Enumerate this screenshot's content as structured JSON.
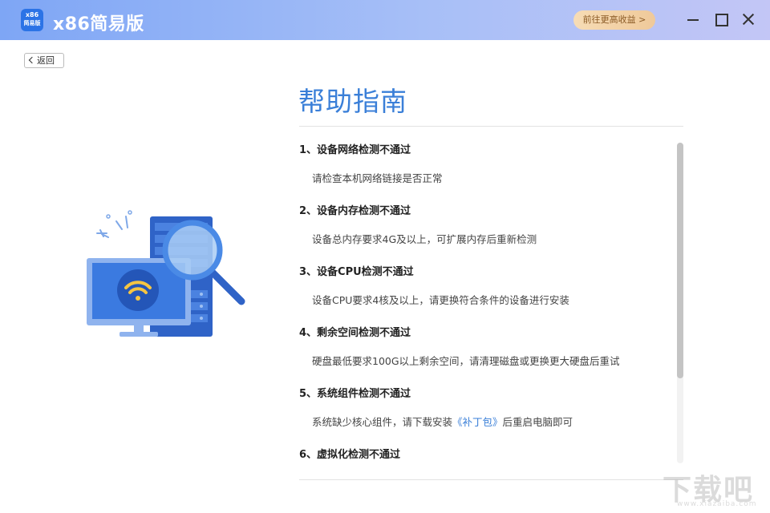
{
  "app": {
    "logo_line1": "x86",
    "logo_line2": "简易版",
    "title": "x86简易版",
    "promo_label": "前往更高收益 >",
    "icons": [
      "minimize-icon",
      "maximize-icon",
      "close-icon"
    ]
  },
  "nav": {
    "back_label": "返回"
  },
  "help": {
    "title": "帮助指南",
    "items": [
      {
        "q": "1、设备网络检测不通过",
        "a": "请检查本机网络链接是否正常"
      },
      {
        "q": "2、设备内存检测不通过",
        "a": "设备总内存要求4G及以上，可扩展内存后重新检测"
      },
      {
        "q": "3、设备CPU检测不通过",
        "a": "设备CPU要求4核及以上，请更换符合条件的设备进行安装"
      },
      {
        "q": "4、剩余空间检测不通过",
        "a": "硬盘最低要求100G以上剩余空间，请清理磁盘或更换更大硬盘后重试"
      },
      {
        "q": "5、系统组件检测不通过",
        "a_before": "系统缺少核心组件，请下载安装",
        "a_link": "《补丁包》",
        "a_after": "后重启电脑即可"
      },
      {
        "q": "6、虚拟化检测不通过"
      }
    ]
  },
  "watermark": {
    "text": "下载吧",
    "sub": "www.xiazaiba.com"
  },
  "colors": {
    "accent": "#3a7fd8",
    "titlebar_start": "#7ea6f5",
    "titlebar_end": "#c3c6f6",
    "promo": "#efc99a"
  }
}
